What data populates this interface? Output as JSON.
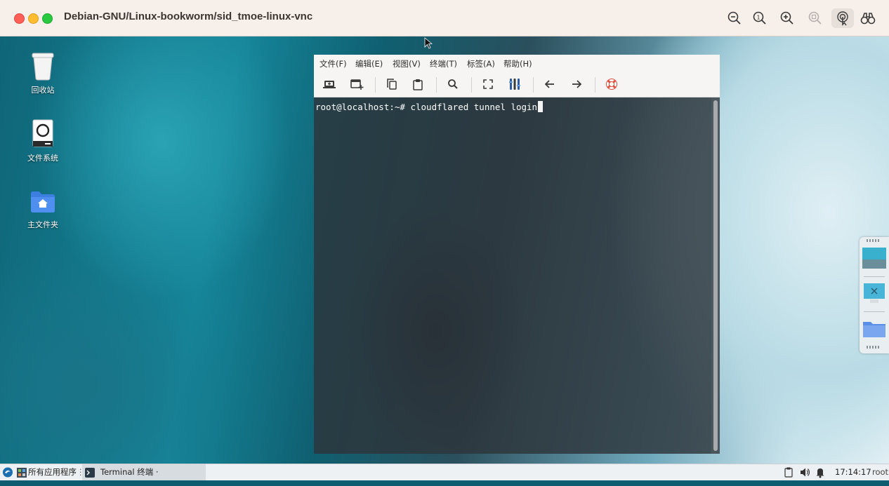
{
  "window": {
    "title": "Debian-GNU/Linux-bookworm/sid_tmoe-linux-vnc",
    "toolbar_icons": [
      "zoom-out-icon",
      "zoom-actual-icon",
      "zoom-in-icon",
      "zoom-fit-icon",
      "touch-pointer-icon",
      "binoculars-icon"
    ]
  },
  "desktop": {
    "icons": [
      {
        "label": "回收站",
        "icon": "trash-icon"
      },
      {
        "label": "文件系统",
        "icon": "drive-icon"
      },
      {
        "label": "主文件夹",
        "icon": "home-folder-icon"
      }
    ]
  },
  "terminal": {
    "menu": [
      "文件(F)",
      "编辑(E)",
      "视图(V)",
      "终端(T)",
      "标签(A)",
      "帮助(H)"
    ],
    "toolbar": [
      "new-tab-icon",
      "new-window-icon",
      "copy-icon",
      "paste-icon",
      "search-icon",
      "fullscreen-icon",
      "columns-icon",
      "back-arrow-icon",
      "forward-arrow-icon",
      "help-lifebuoy-icon"
    ],
    "prompt_line": "root@localhost:~# cloudflared tunnel login"
  },
  "panel": {
    "apps_label": "所有应用程序",
    "task_label": "Terminal 终端 ·",
    "clock": "17:14:17",
    "user": "root"
  },
  "colors": {
    "titlebar_bg": "#f7efe9",
    "terminal_bg": "#2d343a",
    "panel_bg": "#eef1f3"
  }
}
